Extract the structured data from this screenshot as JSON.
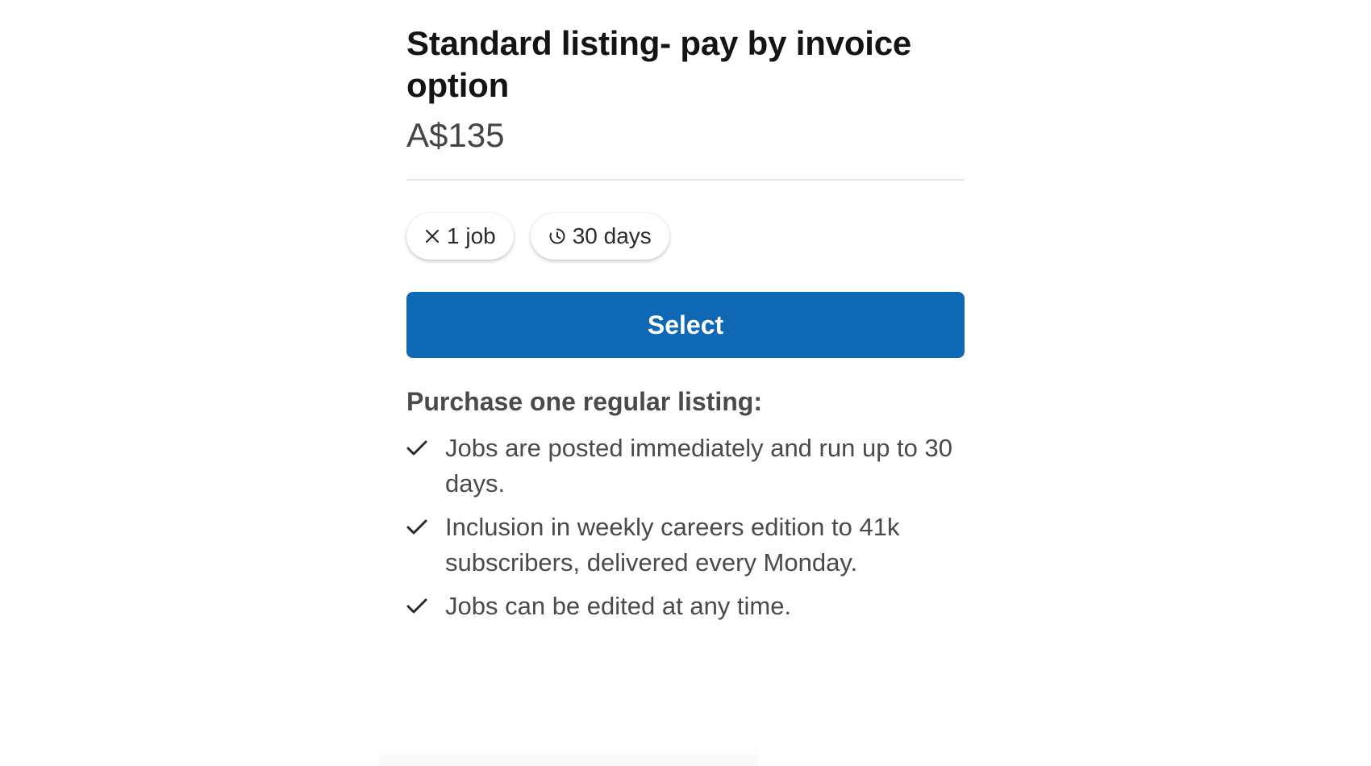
{
  "listing": {
    "title": "Standard listing- pay by invoice option",
    "price": "A$135"
  },
  "chips": [
    {
      "icon": "close-icon",
      "label": "1 job"
    },
    {
      "icon": "clock-icon",
      "label": "30 days"
    }
  ],
  "select_button": {
    "label": "Select",
    "color": "#0f68b4"
  },
  "purchase": {
    "heading": "Purchase one regular listing:",
    "features": [
      {
        "icon": "check-icon",
        "text": "Jobs are posted immediately and run up to 30 days."
      },
      {
        "icon": "check-icon",
        "text": "Inclusion in weekly careers edition to 41k subscribers, delivered every Monday."
      },
      {
        "icon": "check-icon",
        "text": "Jobs can be edited at any time."
      }
    ]
  }
}
